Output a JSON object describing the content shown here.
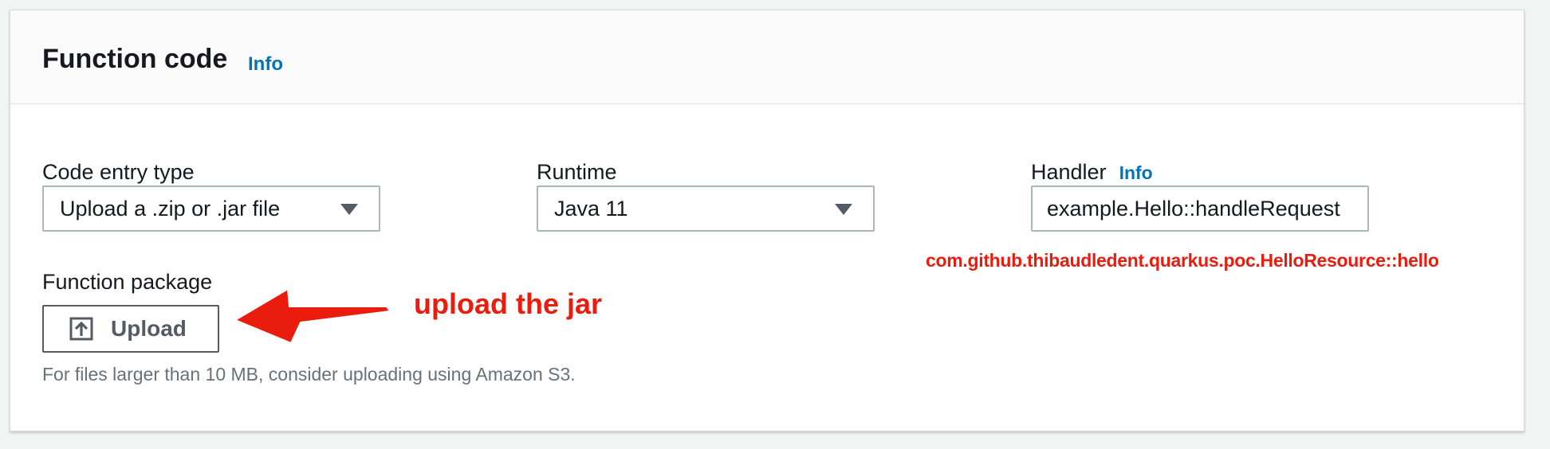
{
  "header": {
    "title": "Function code",
    "info_label": "Info"
  },
  "code_entry": {
    "label": "Code entry type",
    "selected": "Upload a .zip or .jar file"
  },
  "runtime": {
    "label": "Runtime",
    "selected": "Java 11"
  },
  "handler": {
    "label": "Handler",
    "info_label": "Info",
    "value": "example.Hello::handleRequest"
  },
  "function_package": {
    "label": "Function package",
    "upload_label": "Upload",
    "helper_text": "For files larger than 10 MB, consider uploading using Amazon S3."
  },
  "annotations": {
    "handler_note": "com.github.thibaudledent.quarkus.poc.HelloResource::hello",
    "upload_note": "upload the jar"
  },
  "colors": {
    "link": "#0073bb",
    "annotation": "#ea1c0d",
    "text": "#16191f",
    "secondary_text": "#687078"
  },
  "icons": {
    "upload": "upload-icon",
    "dropdown": "caret-down-icon",
    "annotation_arrow": "arrow-left-icon"
  }
}
